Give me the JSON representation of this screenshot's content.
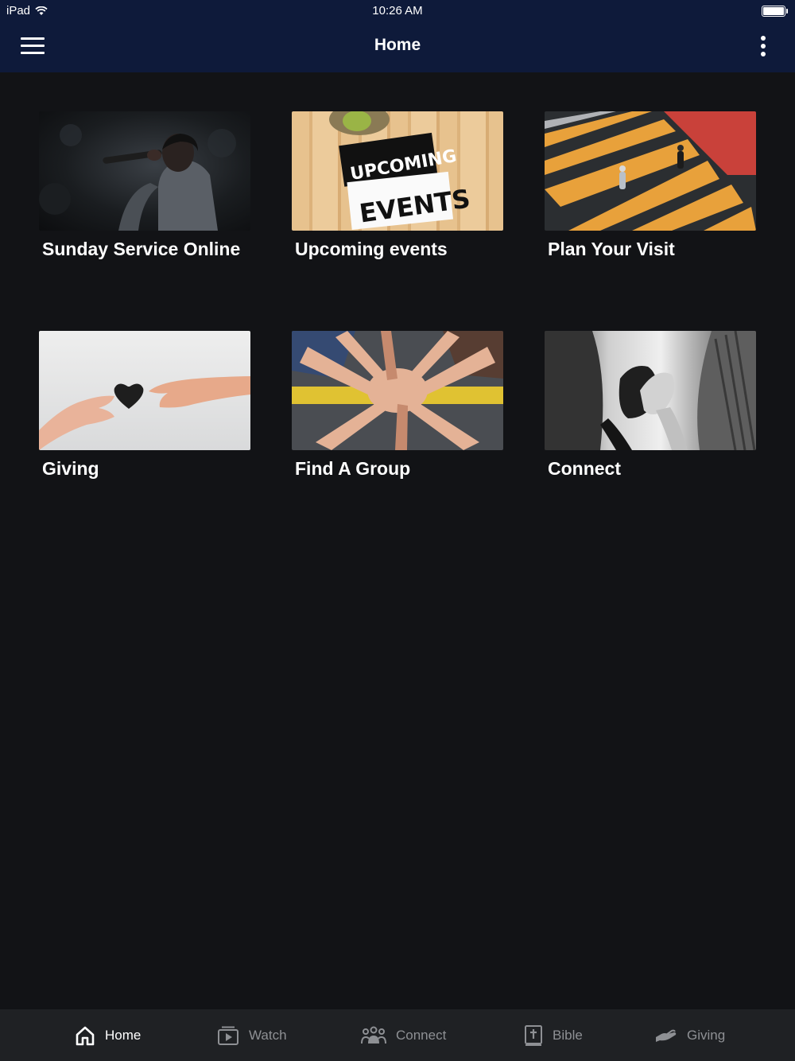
{
  "status": {
    "device": "iPad",
    "time": "10:26 AM"
  },
  "header": {
    "title": "Home",
    "menu_icon": "hamburger-menu-icon",
    "more_icon": "more-vertical-icon"
  },
  "tiles": [
    {
      "label": "Sunday Service Online",
      "image": "singer-with-microphone"
    },
    {
      "label": "Upcoming events",
      "image": "upcoming-events-sign"
    },
    {
      "label": "Plan Your Visit",
      "image": "crosswalk-pedestrians"
    },
    {
      "label": "Giving",
      "image": "hands-passing-heart"
    },
    {
      "label": "Find A Group",
      "image": "stacked-hands"
    },
    {
      "label": "Connect",
      "image": "holding-hands"
    }
  ],
  "events_sign": {
    "line1": "UPCOMING",
    "line2": "EVENTS"
  },
  "tabbar": {
    "items": [
      {
        "label": "Home",
        "icon": "home-icon",
        "active": true
      },
      {
        "label": "Watch",
        "icon": "watch-video-icon",
        "active": false
      },
      {
        "label": "Connect",
        "icon": "people-group-icon",
        "active": false
      },
      {
        "label": "Bible",
        "icon": "bible-icon",
        "active": false
      },
      {
        "label": "Giving",
        "icon": "giving-hand-icon",
        "active": false
      }
    ]
  },
  "colors": {
    "header_bg": "#0e1a3a",
    "page_bg": "#121316",
    "tabbar_bg": "#1f2124",
    "inactive_tab": "#8e9094"
  }
}
